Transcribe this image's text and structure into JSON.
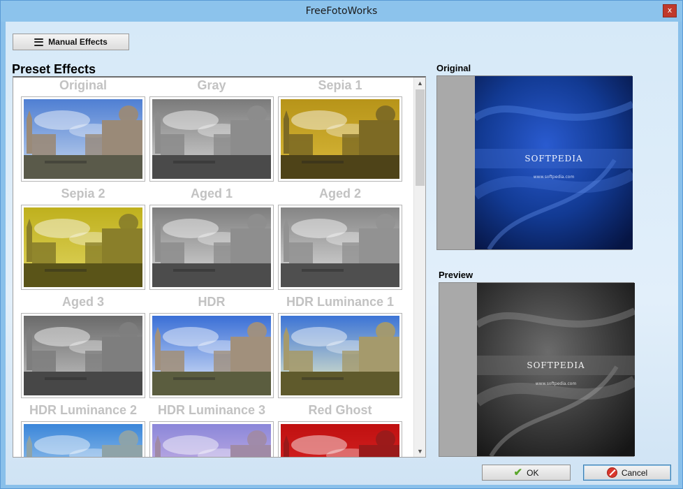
{
  "window": {
    "title": "FreeFotoWorks",
    "close_glyph": "x"
  },
  "toolbar": {
    "manual_effects_label": "Manual Effects",
    "manual_effects_icon": "hamburger-icon"
  },
  "preset": {
    "heading": "Preset Effects",
    "effects": [
      {
        "label": "Original",
        "tone": "original"
      },
      {
        "label": "Gray",
        "tone": "gray"
      },
      {
        "label": "Sepia 1",
        "tone": "sepia1"
      },
      {
        "label": "Sepia 2",
        "tone": "sepia2"
      },
      {
        "label": "Aged 1",
        "tone": "aged1"
      },
      {
        "label": "Aged 2",
        "tone": "aged2"
      },
      {
        "label": "Aged 3",
        "tone": "aged3"
      },
      {
        "label": "HDR",
        "tone": "hdr"
      },
      {
        "label": "HDR Luminance 1",
        "tone": "hdrlum1"
      },
      {
        "label": "HDR Luminance 2",
        "tone": "hdrlum2"
      },
      {
        "label": "HDR Luminance 3",
        "tone": "hdrlum3"
      },
      {
        "label": "Red Ghost",
        "tone": "redghost"
      }
    ]
  },
  "original_panel": {
    "label": "Original",
    "image_text": "SOFTPEDIA",
    "image_subtext": "www.softpedia.com"
  },
  "preview_panel": {
    "label": "Preview",
    "image_text": "SOFTPEDIA",
    "image_subtext": "www.softpedia.com"
  },
  "buttons": {
    "ok_label": "OK",
    "cancel_label": "Cancel"
  },
  "colors": {
    "titlebar": "#8cc3ec",
    "close": "#c0392b",
    "accent": "#3c7fb1"
  }
}
